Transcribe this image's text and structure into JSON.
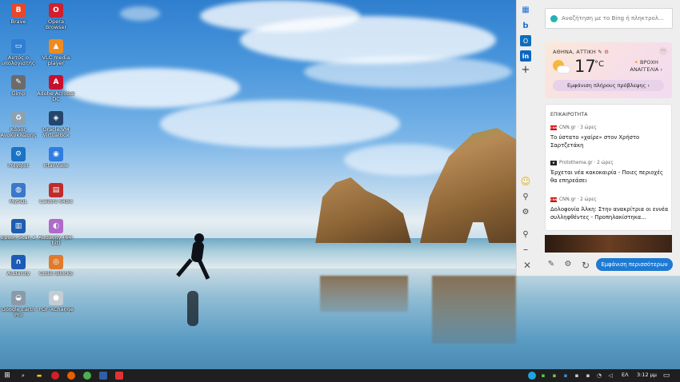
{
  "desktop_icons": [
    {
      "label": "Brave",
      "icon": "brave-icon",
      "color": "#e5482d",
      "glyph": "B"
    },
    {
      "label": "Opera Browser",
      "icon": "opera-icon",
      "color": "#d21f2d",
      "glyph": "O"
    },
    {
      "label": "Αυτός ο υπολογιστής",
      "icon": "this-pc-icon",
      "color": "#2f7fd3",
      "glyph": "▭"
    },
    {
      "label": "VLC media player",
      "icon": "vlc-icon",
      "color": "#f08a1c",
      "glyph": "▲"
    },
    {
      "label": "Gimp",
      "icon": "gimp-icon",
      "color": "#6b6b6b",
      "glyph": "✎"
    },
    {
      "label": "Adobe Acrobat DC",
      "icon": "acrobat-icon",
      "color": "#c8102e",
      "glyph": "A"
    },
    {
      "label": "Κάδος Ανακύκλωσης",
      "icon": "recycle-bin-icon",
      "color": "#8aa2b4",
      "glyph": "♻"
    },
    {
      "label": "Oracle VM VirtualBox",
      "icon": "virtualbox-icon",
      "color": "#23466e",
      "glyph": "◈"
    },
    {
      "label": "Polyglot",
      "icon": "polyglot-icon",
      "color": "#1a73c4",
      "glyph": "⚙"
    },
    {
      "label": "IrfanView",
      "icon": "irfanview-icon",
      "color": "#2f7de0",
      "glyph": "◉"
    },
    {
      "label": "MySQL",
      "icon": "mysql-icon",
      "color": "#3c78c8",
      "glyph": "◍"
    },
    {
      "label": "Calibre 64bit",
      "icon": "calibre-icon",
      "color": "#c22b2b",
      "glyph": "▤"
    },
    {
      "label": "Epson Scan 2",
      "icon": "epson-scan-icon",
      "color": "#1e5db0",
      "glyph": "▥"
    },
    {
      "label": "Audacity (64-bit)",
      "icon": "audacity-icon",
      "color": "#b06ac8",
      "glyph": "◐"
    },
    {
      "label": "Audacity",
      "icon": "audacity-headphones-icon",
      "color": "#1e5bb5",
      "glyph": "∩"
    },
    {
      "label": "Code::Blocks",
      "icon": "codeblocks-icon",
      "color": "#e07a2c",
      "glyph": "◎"
    },
    {
      "label": "Google Earth Pro",
      "icon": "google-earth-icon",
      "color": "#8c9aa8",
      "glyph": "◒"
    },
    {
      "label": "PDF-XChange",
      "icon": "pdf-xchange-icon",
      "color": "#c4ccd4",
      "glyph": "●"
    }
  ],
  "widgets": {
    "search": {
      "placeholder": "Αναζήτηση με το Bing ή πληκτρολ..."
    },
    "rail_icons": [
      "calendar-icon",
      "bing-icon",
      "outlook-icon",
      "linkedin-icon",
      "add-icon"
    ],
    "weather": {
      "location": "ΑΘΗΝΑ, ΑΤΤΙΚΗ",
      "temp": "17",
      "unit": "°C",
      "forecast_line1": "ΒΡΟΧΗ",
      "forecast_line2": "ΑΝΑΓΓΕΛΙΑ",
      "more_label": "···",
      "full_forecast_label": "Εμφάνιση πλήρους πρόβλεψης"
    },
    "news": {
      "section": "ΕΠΙΚΑΙΡΟΤΗΤΑ",
      "items": [
        {
          "source": "CNN.gr · 3 ώρες",
          "logo": "CNN",
          "logo_color": "#cc0000",
          "title": "Το ύστατο «χαίρε» στον Χρήστο Σαρτζετάκη"
        },
        {
          "source": "Protothema.gr · 2 ώρες",
          "logo": "θ",
          "logo_color": "#222222",
          "title": "Έρχεται νέα κακοκαιρία - Ποιες περιοχές θα επηρεάσει"
        },
        {
          "source": "CNN.gr · 2 ώρες",
          "logo": "CNN",
          "logo_color": "#cc0000",
          "title": "Δολοφονία Άλκη: Στην ανακρίτρια οι εννέα συλληφθέντες - Προπηλακίστηκα..."
        }
      ]
    },
    "show_more_label": "Εμφάνιση περισσότερων"
  },
  "taskbar": {
    "language": "ΕΛ",
    "time": "3:12 μμ"
  }
}
